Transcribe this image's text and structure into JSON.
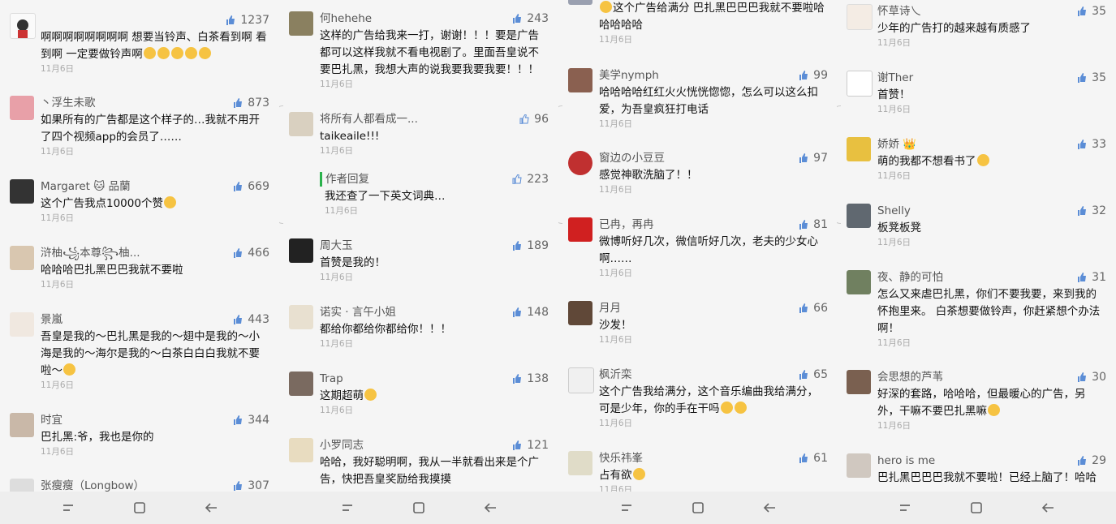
{
  "panels": [
    {
      "comments": [
        {
          "user": "",
          "likes": "1237",
          "text": "啊啊啊啊啊啊啊啊 想要当铃声、白茶看到啊 看到啊 一定要做铃声啊",
          "time": "11月6日"
        },
        {
          "user": "丶浮生未歌",
          "likes": "873",
          "text": "如果所有的广告都是这个样子的…我就不用开了四个视频app的会员了……",
          "time": "11月6日"
        },
        {
          "user": "Margaret 🐱 品蘭",
          "likes": "669",
          "text": "这个广告我点10000个赞",
          "time": "11月6日"
        },
        {
          "user": "浒柚꧁本尊꧂柚...",
          "likes": "466",
          "text": "哈哈哈巴扎黑巴巴我就不要啦",
          "time": "11月6日"
        },
        {
          "user": "景嵐",
          "likes": "443",
          "text": "吾皇是我的～巴扎黑是我的～翅中是我的～小海是我的～海尔是我的～白茶白白白我就不要啦～",
          "time": "11月6日"
        },
        {
          "user": "时宜",
          "likes": "344",
          "text": "巴扎黑:爷，我也是你的",
          "time": "11月6日"
        },
        {
          "user": "张瘦瘦（Longbow）",
          "likes": "307",
          "text": "",
          "time": ""
        }
      ]
    },
    {
      "comments": [
        {
          "user": "何hehehe",
          "likes": "243",
          "text": "这样的广告给我来一打，谢谢！！！要是广告都可以这样我就不看电视剧了。里面吾皇说不要巴扎黑，我想大声的说我要我要我要！！！",
          "time": "11月6日"
        },
        {
          "user": "将所有人都看成一...",
          "likes": "96",
          "text": "taikeaile!!!",
          "time": "11月6日"
        },
        {
          "user": "作者回复",
          "likes": "223",
          "text": "我还查了一下英文词典…",
          "time": "11月6日"
        },
        {
          "user": "周大玉",
          "likes": "189",
          "text": "首赞是我的！",
          "time": "11月6日"
        },
        {
          "user": "诺实 · 言午小姐",
          "likes": "148",
          "text": "都给你都给你都给你！！！",
          "time": "11月6日"
        },
        {
          "user": "Trap",
          "likes": "138",
          "text": "这期超萌",
          "time": "11月6日"
        },
        {
          "user": "小罗同志",
          "likes": "121",
          "text": "哈哈，我好聪明啊，我从一半就看出来是个广告，快把吾皇奖励给我摸摸",
          "time": "11月6日"
        }
      ]
    },
    {
      "comments": [
        {
          "user": "",
          "likes": "",
          "text": "这个广告给满分 巴扎黑巴巴巴我就不要啦哈哈哈哈哈",
          "time": "11月6日"
        },
        {
          "user": "美学nymph",
          "likes": "99",
          "text": "哈哈哈哈红红火火恍恍惚惚，怎么可以这么扣爱，为吾皇疯狂打电话",
          "time": "11月6日"
        },
        {
          "user": "窗边の小豆豆",
          "likes": "97",
          "text": "感觉神歌洗脑了！！",
          "time": "11月6日"
        },
        {
          "user": "已冉，再冉",
          "likes": "81",
          "text": "微博听好几次，微信听好几次，老夫的少女心啊……",
          "time": "11月6日"
        },
        {
          "user": "月月",
          "likes": "66",
          "text": "沙发！",
          "time": "11月6日"
        },
        {
          "user": "枫沂栾",
          "likes": "65",
          "text": "这个广告我给满分，这个音乐编曲我给满分，可是少年，你的手在干吗",
          "time": "11月6日"
        },
        {
          "user": "快乐祎峯",
          "likes": "61",
          "text": "占有欲",
          "time": "11月6日"
        }
      ]
    },
    {
      "comments": [
        {
          "user": "怀草诗乀",
          "likes": "35",
          "text": "少年的广告打的越来越有质感了",
          "time": "11月6日"
        },
        {
          "user": "谢Ther",
          "likes": "35",
          "text": "首赞！",
          "time": "11月6日"
        },
        {
          "user": "娇娇 👑",
          "likes": "33",
          "text": "萌的我都不想看书了",
          "time": "11月6日"
        },
        {
          "user": "Shelly",
          "likes": "32",
          "text": "板凳板凳",
          "time": "11月6日"
        },
        {
          "user": "夜、静的可怕",
          "likes": "31",
          "text": "怎么又来虐巴扎黑，你们不要我要，来到我的怀抱里来。 白茶想要做铃声，你赶紧想个办法啊！",
          "time": "11月6日"
        },
        {
          "user": "会思想的芦苇",
          "likes": "30",
          "text": "好深的套路，哈哈哈，但最暖心的广告，另外，干嘛不要巴扎黑嘛",
          "time": "11月6日"
        },
        {
          "user": "hero is me",
          "likes": "29",
          "text": "巴扎黑巴巴巴我就不要啦！已经上脑了！哈哈",
          "time": ""
        }
      ]
    }
  ],
  "colors": {
    "background": "#f5f5f5",
    "navbar": "#eeeeee",
    "thumb": "#5b8dd6",
    "reply_bar": "#2bb24c"
  }
}
